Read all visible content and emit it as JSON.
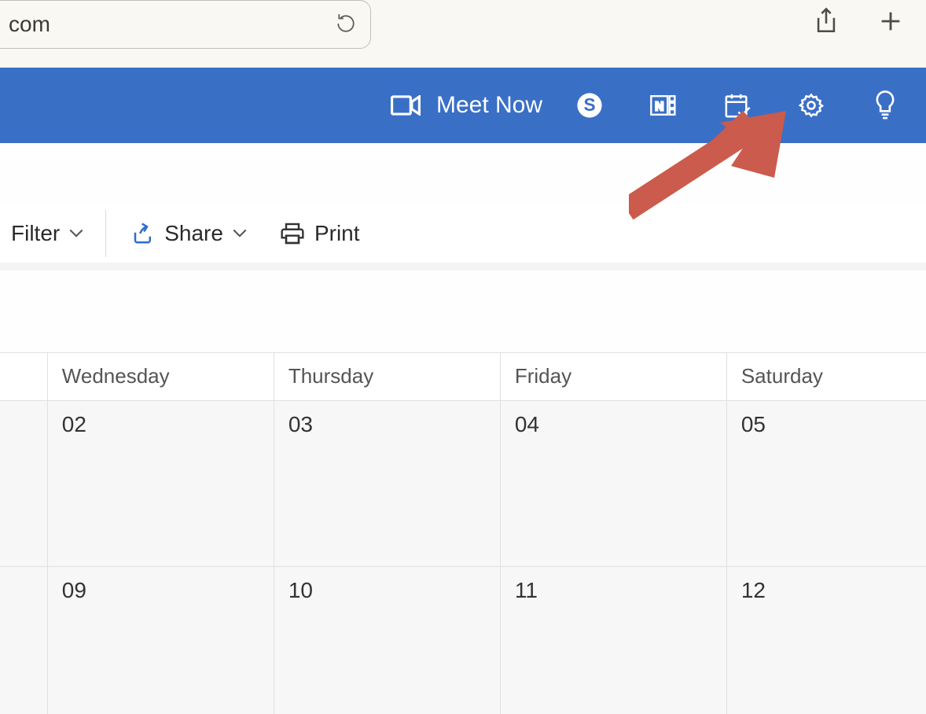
{
  "browser": {
    "url_fragment": "com"
  },
  "header": {
    "meet_label": "Meet Now"
  },
  "toolbar": {
    "filter_label": "Filter",
    "share_label": "Share",
    "print_label": "Print"
  },
  "calendar": {
    "days": [
      "Wednesday",
      "Thursday",
      "Friday",
      "Saturday"
    ],
    "week1": [
      "02",
      "03",
      "04",
      "05"
    ],
    "week2": [
      "09",
      "10",
      "11",
      "12"
    ]
  }
}
